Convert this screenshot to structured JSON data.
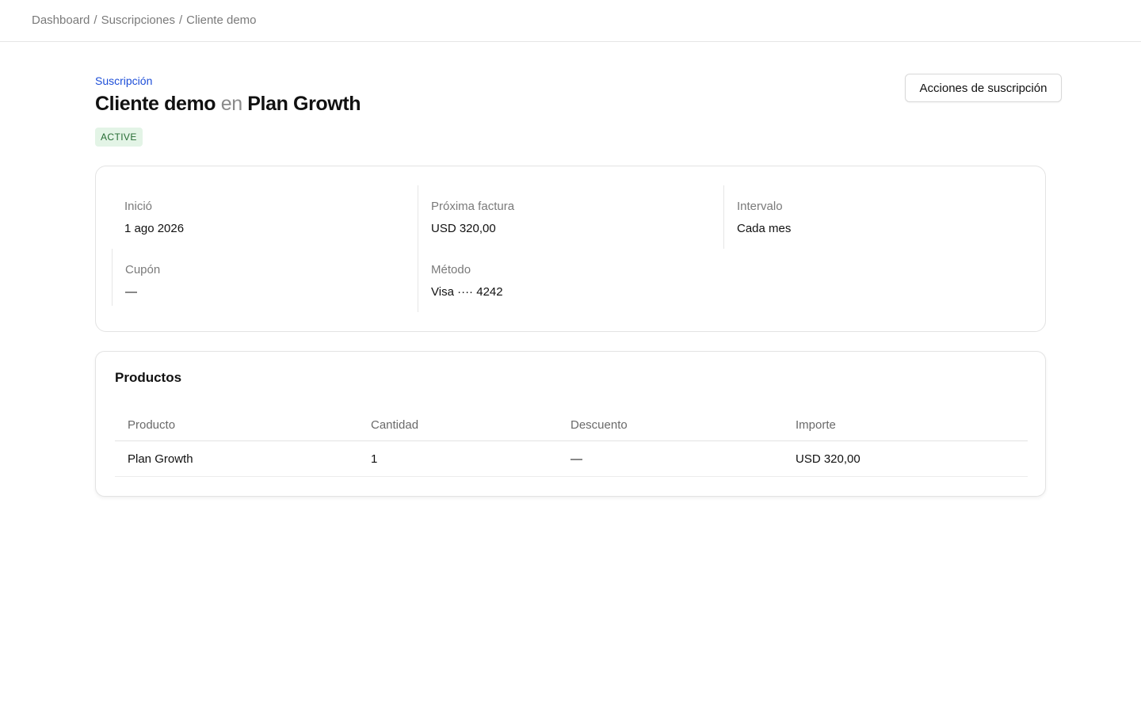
{
  "breadcrumb": {
    "items": [
      "Dashboard",
      "Suscripciones",
      "Cliente demo"
    ],
    "separator": "/"
  },
  "header": {
    "eyebrow": "Suscripción",
    "customer": "Cliente demo",
    "connector": "en",
    "plan": "Plan Growth",
    "status": "ACTIVE",
    "actions_label": "Acciones de suscripción"
  },
  "summary": {
    "start_label": "Inició",
    "start_value": "1 ago 2026",
    "next_invoice_label": "Próxima factura",
    "next_invoice_value": "USD 320,00",
    "interval_label": "Intervalo",
    "interval_value": "Cada mes",
    "coupon_label": "Cupón",
    "coupon_value": "—",
    "method_label": "Método",
    "method_value": "Visa ···· 4242"
  },
  "products": {
    "title": "Productos",
    "columns": [
      "Producto",
      "Cantidad",
      "Descuento",
      "Importe"
    ],
    "rows": [
      [
        "Plan Growth",
        "1",
        "—",
        "USD 320,00"
      ]
    ]
  },
  "colors": {
    "accent": "#1d4ed8",
    "status_bg": "#e3f4e6",
    "status_text": "#256b33"
  }
}
